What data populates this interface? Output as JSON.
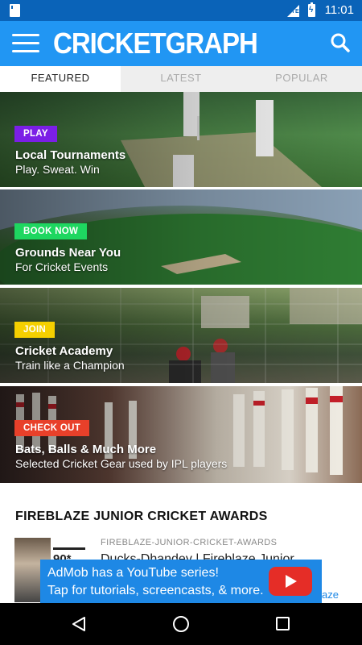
{
  "status_bar": {
    "network": "LTE",
    "time": "11:01"
  },
  "app_bar": {
    "title": "CRICKETGRAPH"
  },
  "tabs": [
    {
      "label": "FEATURED",
      "active": true
    },
    {
      "label": "LATEST",
      "active": false
    },
    {
      "label": "POPULAR",
      "active": false
    }
  ],
  "cards": [
    {
      "badge": "PLAY",
      "badge_color": "#7b1fe6",
      "title": "Local Tournaments",
      "subtitle": "Play. Sweat. Win"
    },
    {
      "badge": "BOOK NOW",
      "badge_color": "#1ed760",
      "title": "Grounds Near You",
      "subtitle": "For Cricket Events"
    },
    {
      "badge": "JOIN",
      "badge_color": "#f5d000",
      "title": "Cricket Academy",
      "subtitle": "Train like a Champion"
    },
    {
      "badge": "CHECK OUT",
      "badge_color": "#e8402a",
      "title": "Bats, Balls & Much More",
      "subtitle": "Selected Cricket Gear used by IPL players"
    }
  ],
  "section": {
    "title": "FIREBLAZE JUNIOR CRICKET AWARDS"
  },
  "article": {
    "category": "FIREBLAZE-JUNIOR-CRICKET-AWARDS",
    "title": "Ducks-Dhandey | Fireblaze Junior",
    "thumb_score": "90*"
  },
  "ad": {
    "line1": "AdMob has a YouTube series!",
    "line2": "Tap for tutorials, screencasts, & more.",
    "peek_text": "aze"
  },
  "colors": {
    "primary": "#2196f3",
    "status_bar": "#0a63b8"
  }
}
